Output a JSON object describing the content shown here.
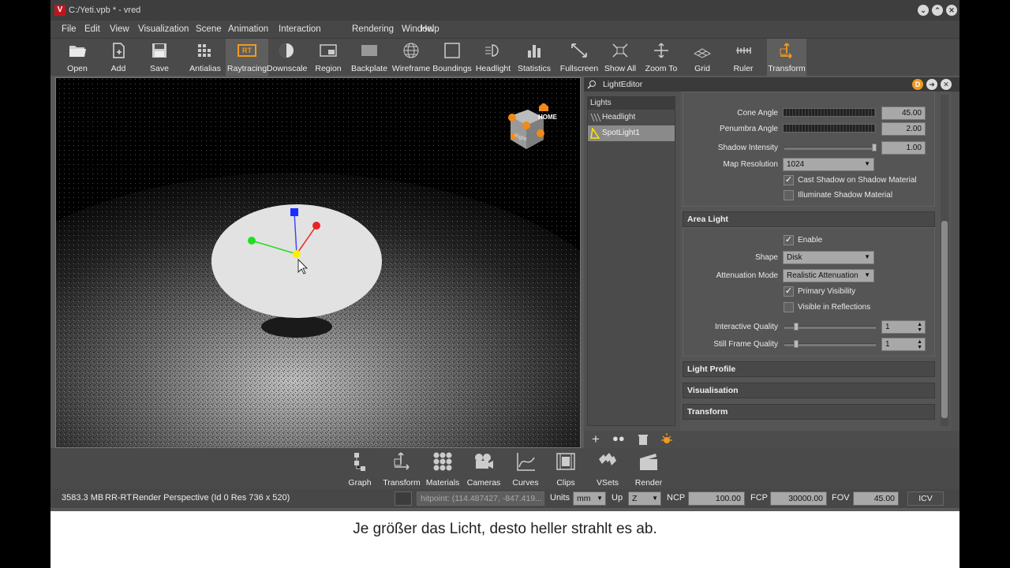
{
  "window": {
    "title": "C:/Yeti.vpb * - vred",
    "logo": "V"
  },
  "menu": [
    "File",
    "Edit",
    "View",
    "Visualization",
    "Scene",
    "Animation",
    "Interaction",
    "Rendering",
    "Window",
    "Help"
  ],
  "toolbar": [
    "Open",
    "Add",
    "Save",
    "Antialias",
    "Raytracing",
    "Downscale",
    "Region",
    "Backplate",
    "Wireframe",
    "Boundings",
    "Headlight",
    "Statistics",
    "Fullscreen",
    "Show All",
    "Zoom To",
    "Grid",
    "Ruler",
    "Transform"
  ],
  "toolbar_badge": "RT",
  "viewport": {
    "home_label": "HOME",
    "cube_label": "Right"
  },
  "light_editor": {
    "title": "LightEditor",
    "lights_header": "Lights",
    "lights": [
      "Headlight",
      "SpotLight1"
    ],
    "cone_angle_label": "Cone Angle",
    "cone_angle": "45.00",
    "penumbra_label": "Penumbra Angle",
    "penumbra": "2.00",
    "shadow_intensity_label": "Shadow Intensity",
    "shadow_intensity": "1.00",
    "map_resolution_label": "Map Resolution",
    "map_resolution": "1024",
    "cast_shadow": "Cast Shadow on Shadow Material",
    "illuminate_shadow": "Illuminate Shadow Material",
    "area_light": "Area Light",
    "enable": "Enable",
    "shape_label": "Shape",
    "shape": "Disk",
    "attenuation_label": "Attenuation Mode",
    "attenuation": "Realistic Attenuation",
    "primary_visibility": "Primary Visibility",
    "visible_reflections": "Visible in Reflections",
    "interactive_quality_label": "Interactive Quality",
    "interactive_quality": "1",
    "still_quality_label": "Still Frame Quality",
    "still_quality": "1",
    "light_profile": "Light Profile",
    "visualisation": "Visualisation",
    "transform": "Transform"
  },
  "bottom_tools": [
    "Graph",
    "Transform",
    "Materials",
    "Cameras",
    "Curves",
    "Clips",
    "VSets",
    "Render"
  ],
  "status": {
    "memory": "3583.3 MB",
    "mode": "RR-RT",
    "render_info": "Render Perspective (Id 0 Res 736 x 520)",
    "hitpoint": "hitpoint: (114.487427, -847.419...",
    "units_label": "Units",
    "units": "mm",
    "up_label": "Up",
    "up": "Z",
    "ncp_label": "NCP",
    "ncp": "100.00",
    "fcp_label": "FCP",
    "fcp": "30000.00",
    "fov_label": "FOV",
    "fov": "45.00",
    "icv": "ICV"
  },
  "subtitle": "Je größer das Licht, desto heller strahlt es ab."
}
